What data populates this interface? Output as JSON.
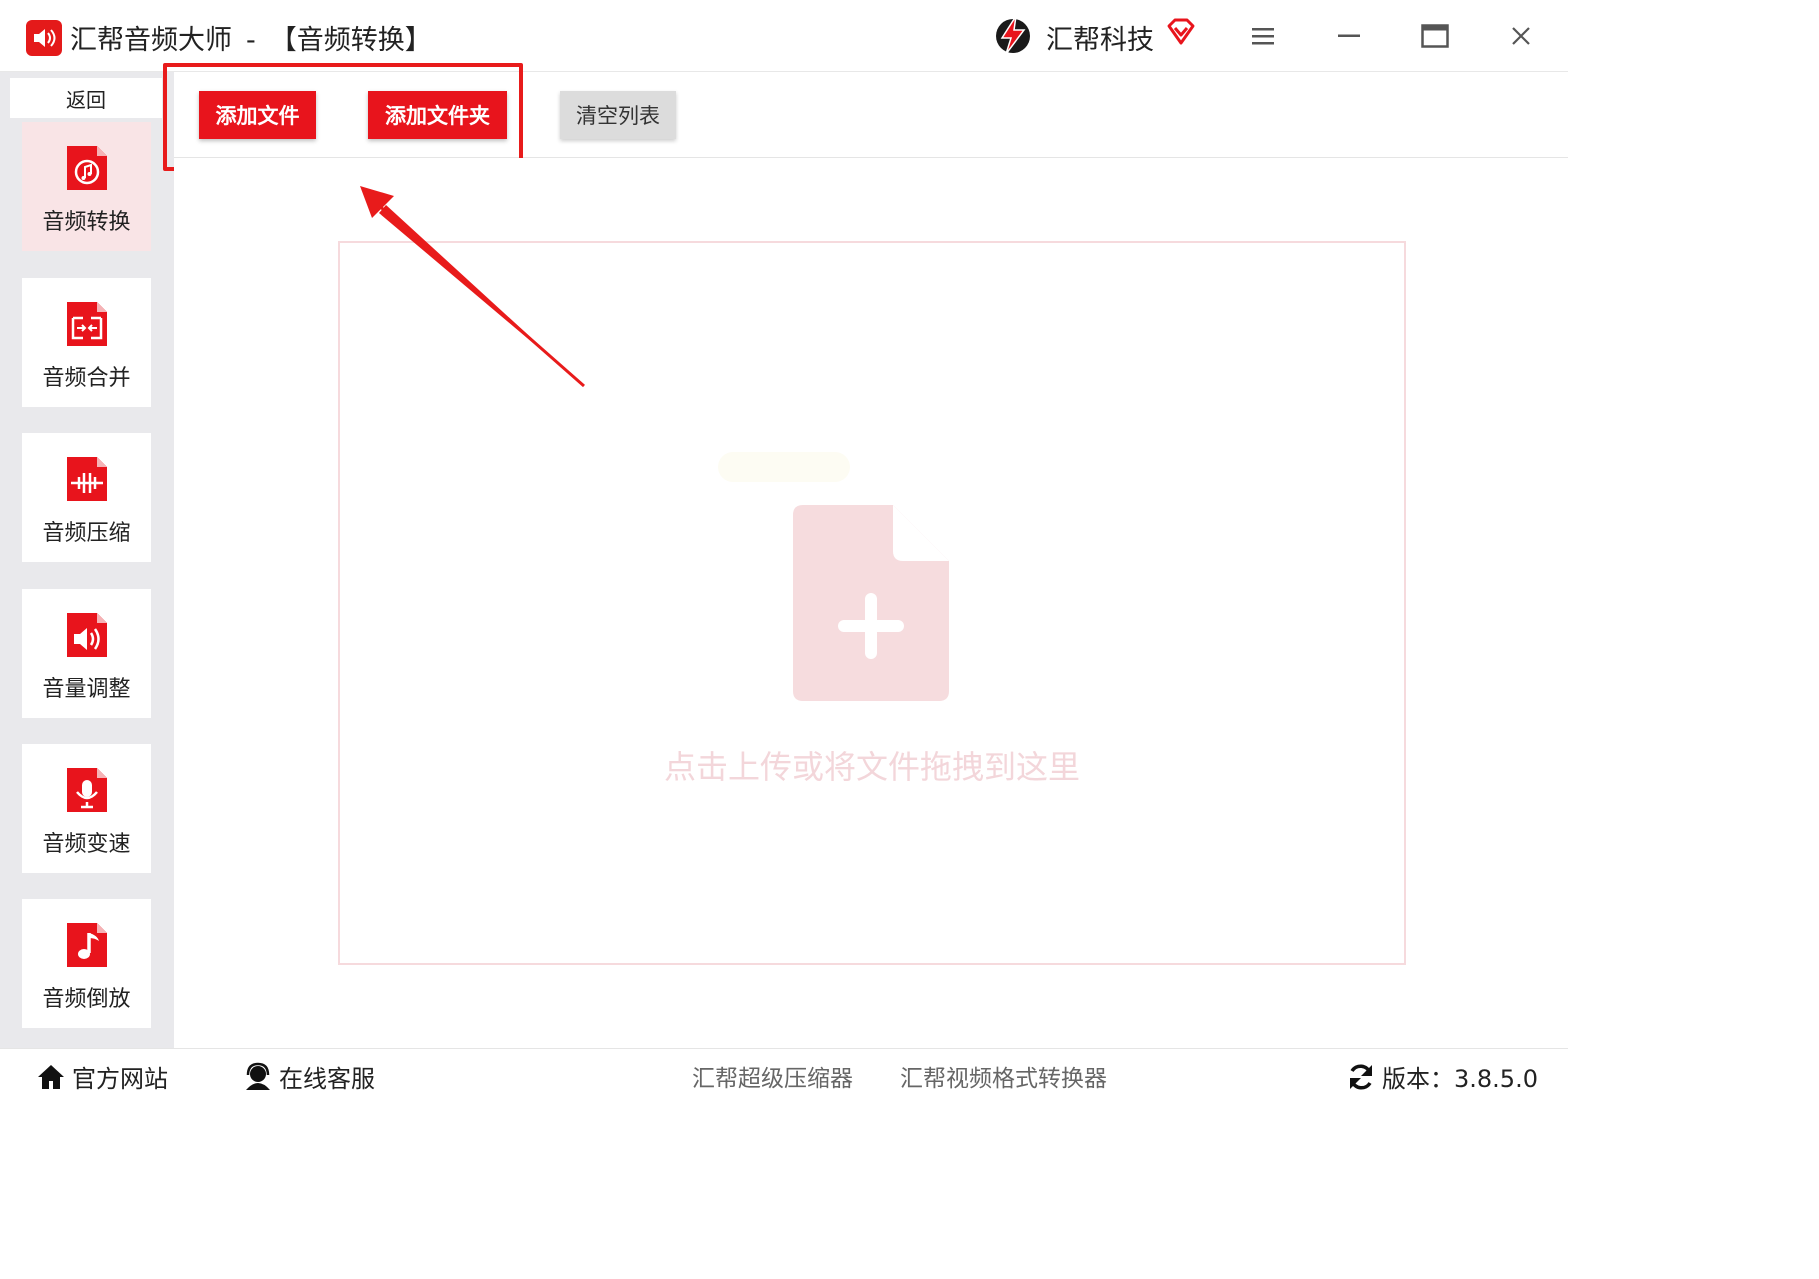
{
  "window": {
    "app_name": "汇帮音频大师",
    "separator": "-",
    "current_module": "【音频转换】",
    "brand": "汇帮科技"
  },
  "sidebar": {
    "back_label": "返回",
    "items": [
      {
        "label": "音频转换",
        "icon": "audio-convert-icon",
        "active": true
      },
      {
        "label": "音频合并",
        "icon": "audio-merge-icon",
        "active": false
      },
      {
        "label": "音频压缩",
        "icon": "audio-compress-icon",
        "active": false
      },
      {
        "label": "音量调整",
        "icon": "volume-adjust-icon",
        "active": false
      },
      {
        "label": "音频变速",
        "icon": "audio-speed-icon",
        "active": false
      },
      {
        "label": "音频倒放",
        "icon": "audio-reverse-icon",
        "active": false
      }
    ]
  },
  "toolbar": {
    "add_file_label": "添加文件",
    "add_folder_label": "添加文件夹",
    "clear_list_label": "清空列表"
  },
  "dropzone": {
    "hint": "点击上传或将文件拖拽到这里"
  },
  "footer": {
    "official_site": "官方网站",
    "online_service": "在线客服",
    "compressor_link": "汇帮超级压缩器",
    "video_converter_link": "汇帮视频格式转换器",
    "version_label": "版本：3.8.5.0"
  },
  "colors": {
    "accent": "#e8141c",
    "active_bg": "#f9e4e6",
    "sidebar_bg": "#e9e9ec",
    "dropzone_border": "#f6dadd"
  }
}
